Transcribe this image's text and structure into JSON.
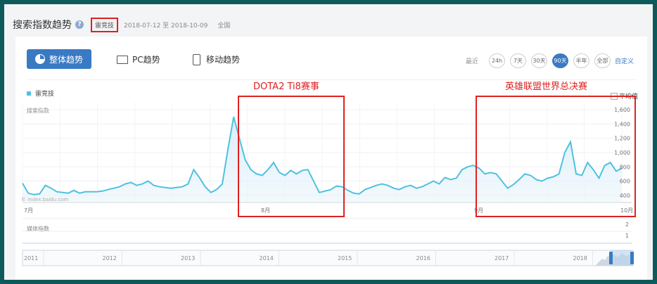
{
  "header": {
    "title": "搜索指数趋势",
    "keyword": "雷竞技",
    "date_range": "2018-07-12 至 2018-10-09",
    "region": "全国"
  },
  "toolbar": {
    "overall_label": "整体趋势",
    "pc_label": "PC趋势",
    "mobile_label": "移动趋势",
    "recent_label": "最近",
    "ranges": [
      "24h",
      "7天",
      "30天",
      "90天",
      "半年",
      "全部"
    ],
    "active_range": "90天",
    "custom_label": "自定义"
  },
  "legend": {
    "series_name": "雷竞技",
    "average_label": "平均值"
  },
  "annotations": {
    "dota": "DOTA2 Ti8赛事",
    "lol": "英雄联盟世界总决赛"
  },
  "labels": {
    "search_index": "搜索指数",
    "media_index": "媒体指数",
    "watermark": "© index.baidu.com"
  },
  "colors": {
    "accent": "#3a7ac3",
    "line": "#4fc1e0",
    "annotation": "#e02020"
  },
  "chart_data": {
    "type": "area",
    "ylabel": "搜索指数",
    "ylim": [
      300,
      1700
    ],
    "y_ticks": [
      "400",
      "600",
      "800",
      "1,000",
      "1,200",
      "1,400",
      "1,600"
    ],
    "x_ticks": [
      "7月",
      "8月",
      "9月",
      "10月"
    ],
    "values": [
      570,
      430,
      410,
      420,
      540,
      500,
      450,
      440,
      430,
      470,
      430,
      450,
      450,
      450,
      460,
      480,
      500,
      520,
      560,
      580,
      540,
      560,
      600,
      540,
      520,
      510,
      500,
      510,
      520,
      560,
      760,
      650,
      520,
      440,
      480,
      560,
      1050,
      1500,
      1200,
      900,
      760,
      700,
      680,
      760,
      860,
      720,
      680,
      750,
      700,
      750,
      760,
      600,
      440,
      460,
      480,
      530,
      520,
      470,
      430,
      420,
      480,
      510,
      540,
      560,
      540,
      500,
      480,
      520,
      540,
      500,
      520,
      560,
      600,
      560,
      650,
      620,
      640,
      760,
      800,
      820,
      780,
      700,
      720,
      700,
      600,
      500,
      550,
      620,
      700,
      680,
      620,
      600,
      640,
      660,
      700,
      1000,
      1150,
      700,
      680,
      860,
      760,
      640,
      820,
      860,
      740,
      780
    ],
    "media_index": {
      "label": "媒体指数",
      "y_ticks": [
        "2",
        "1"
      ],
      "values": [
        0,
        0,
        0,
        0,
        0,
        0
      ]
    },
    "timeline": {
      "years": [
        "2011",
        "2012",
        "2013",
        "2014",
        "2015",
        "2016",
        "2017",
        "2018"
      ]
    }
  }
}
